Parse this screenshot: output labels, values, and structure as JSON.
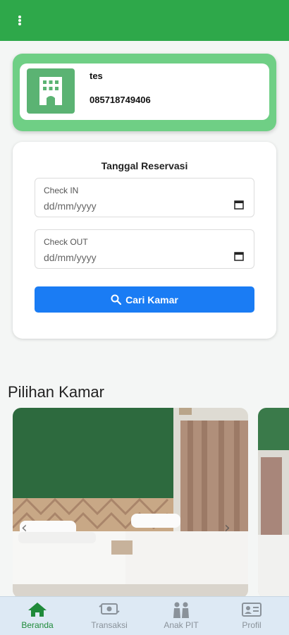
{
  "colors": {
    "topbar": "#2ea84a",
    "profile_card": "#6fcf85",
    "accent_button": "#1a7cf4",
    "active_nav": "#1f8a3a",
    "inactive_nav": "#8a929a"
  },
  "header": {
    "menu_icon": "kebab-menu-icon"
  },
  "profile": {
    "icon": "hotel-building-icon",
    "name": "tes",
    "phone": "085718749406"
  },
  "reservation": {
    "title": "Tanggal Reservasi",
    "check_in": {
      "label": "Check IN",
      "placeholder": "dd/mm/yyyy",
      "icon": "calendar-icon"
    },
    "check_out": {
      "label": "Check OUT",
      "placeholder": "dd/mm/yyyy",
      "icon": "calendar-icon"
    },
    "search_button": {
      "label": "Cari Kamar",
      "icon": "search-icon"
    }
  },
  "rooms": {
    "title": "Pilihan Kamar",
    "prev_icon": "‹",
    "next_icon": "›"
  },
  "bottom_nav": {
    "items": [
      {
        "label": "Beranda",
        "icon": "home-icon",
        "active": true
      },
      {
        "label": "Transaksi",
        "icon": "money-icon",
        "active": false
      },
      {
        "label": "Anak PIT",
        "icon": "people-icon",
        "active": false
      },
      {
        "label": "Profil",
        "icon": "id-card-icon",
        "active": false
      }
    ]
  }
}
